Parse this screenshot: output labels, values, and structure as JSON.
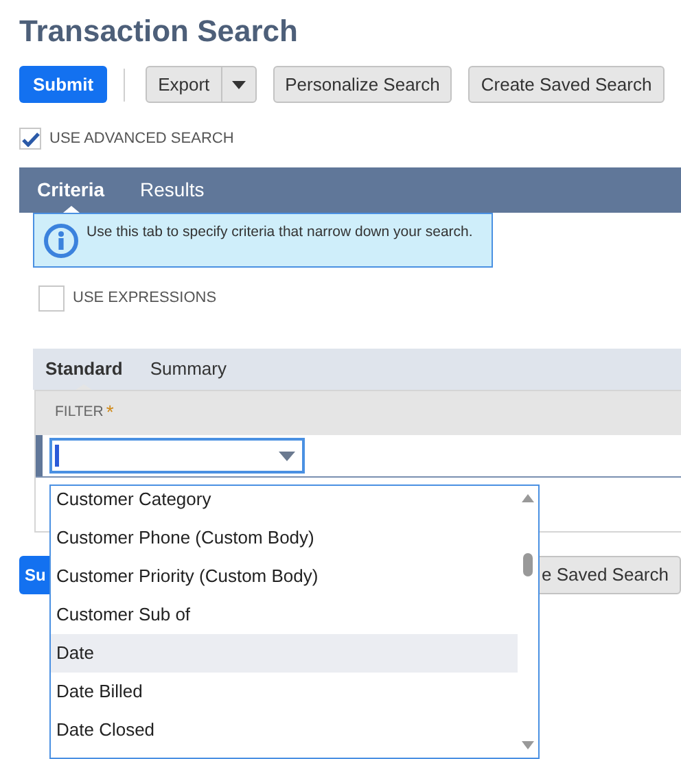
{
  "title": "Transaction Search",
  "toolbar": [
    {
      "label": "Submit",
      "kind": "primary"
    },
    {
      "label": "Export",
      "kind": "split"
    },
    {
      "label": "Personalize Search",
      "kind": "plain"
    },
    {
      "label": "Create Saved Search",
      "kind": "plain"
    }
  ],
  "advanced_search": {
    "label": "USE ADVANCED SEARCH",
    "checked": true
  },
  "tabs": [
    {
      "label": "Criteria",
      "selected": true
    },
    {
      "label": "Results",
      "selected": false
    }
  ],
  "info": "Use this tab to specify criteria that narrow down your search.",
  "use_expressions": {
    "label": "USE EXPRESSIONS",
    "checked": false
  },
  "subtabs": [
    {
      "label": "Standard",
      "selected": true
    },
    {
      "label": "Summary",
      "selected": false
    }
  ],
  "filter": {
    "header": "FILTER",
    "required_mark": "*"
  },
  "dropdown": [
    {
      "label": "Customer Category",
      "selected": false
    },
    {
      "label": "Customer Phone (Custom Body)",
      "selected": false
    },
    {
      "label": "Customer Priority (Custom Body)",
      "selected": false
    },
    {
      "label": "Customer Sub of",
      "selected": false
    },
    {
      "label": "Date",
      "selected": true
    },
    {
      "label": "Date Billed",
      "selected": false
    },
    {
      "label": "Date Closed",
      "selected": false
    }
  ],
  "bottom_buttons": [
    {
      "label": "Su",
      "kind": "primary"
    },
    {
      "label": "e Saved Search",
      "kind": "plain"
    }
  ]
}
